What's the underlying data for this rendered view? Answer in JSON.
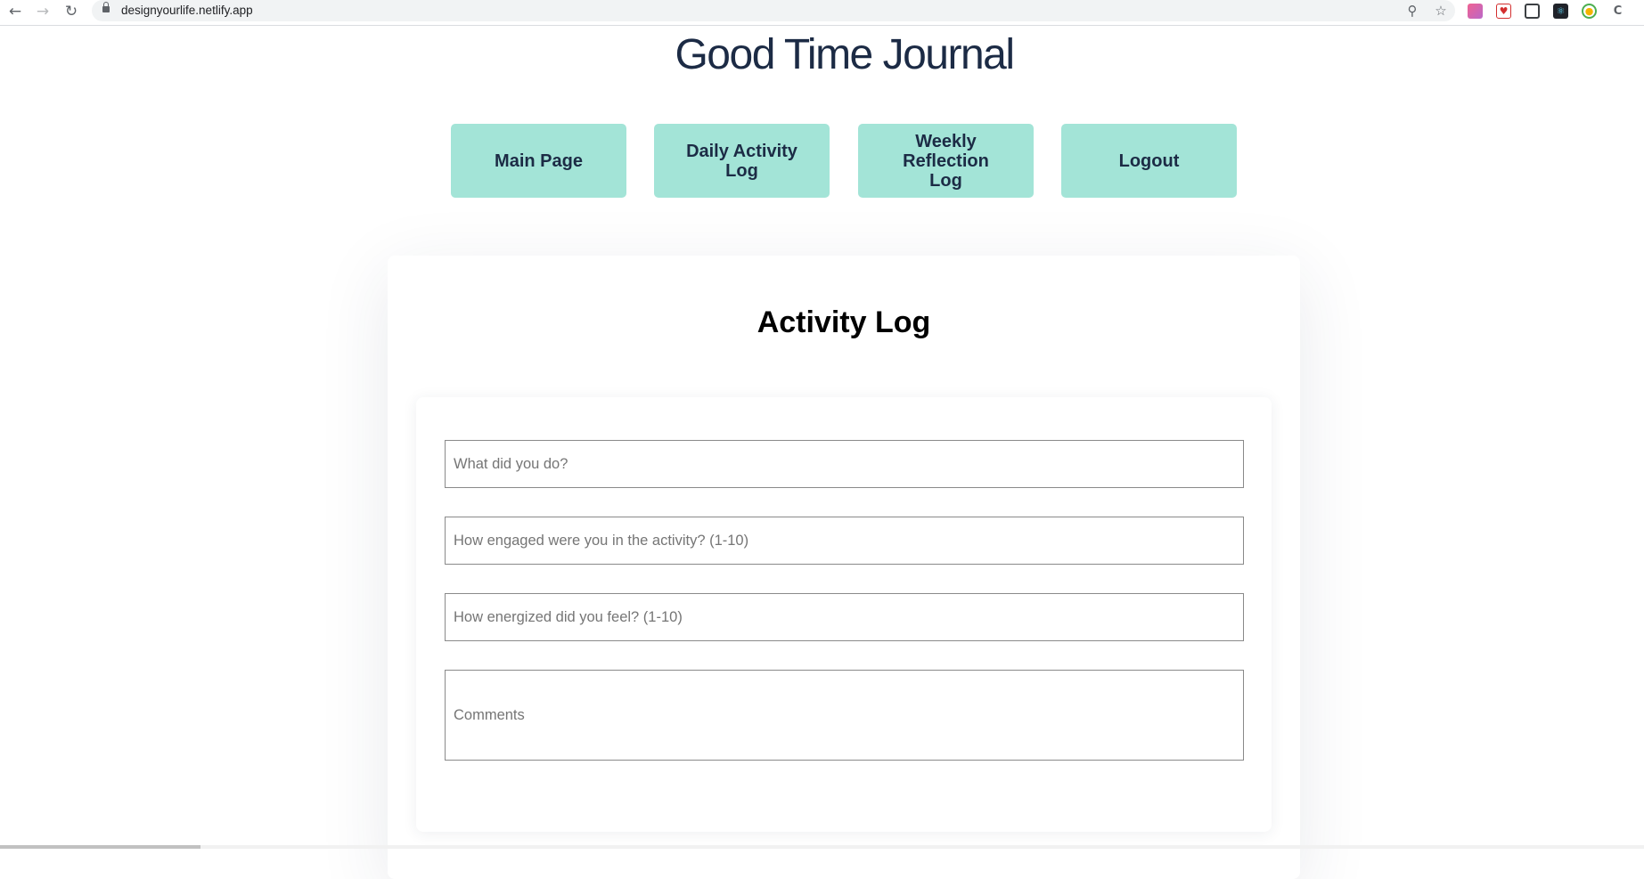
{
  "browser": {
    "url": "designyourlife.netlify.app",
    "icons": [
      "back-arrow-icon",
      "forward-arrow-icon",
      "reload-icon",
      "lock-icon",
      "key-icon",
      "star-icon"
    ]
  },
  "site": {
    "title": "Good Time Journal"
  },
  "nav": {
    "main_page": "Main Page",
    "daily_activity_log": "Daily Activity Log",
    "weekly_reflection_log": "Weekly Reflection Log",
    "logout": "Logout"
  },
  "activity_log": {
    "title": "Activity Log",
    "fields": {
      "activity_placeholder": "What did you do?",
      "engagement_placeholder": "How engaged were you in the activity? (1-10)",
      "energy_placeholder": "How energized did you feel? (1-10)",
      "comments_placeholder": "Comments"
    }
  },
  "colors": {
    "nav_button_bg": "#a3e4d7",
    "title_text": "#1c2b45"
  }
}
